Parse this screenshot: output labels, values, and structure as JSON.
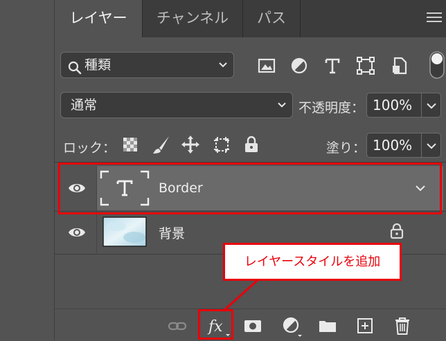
{
  "tabs": [
    {
      "label": "レイヤー",
      "active": true
    },
    {
      "label": "チャンネル",
      "active": false
    },
    {
      "label": "パス",
      "active": false
    }
  ],
  "filter": {
    "kind_label": "種類"
  },
  "blend": {
    "mode": "通常",
    "opacity_label": "不透明度：",
    "opacity_value": "100%"
  },
  "lock": {
    "label": "ロック：",
    "fill_label": "塗り：",
    "fill_value": "100%"
  },
  "layers": [
    {
      "name": "Border",
      "type": "text",
      "selected": true
    },
    {
      "name": "背景",
      "type": "image",
      "locked": true
    }
  ],
  "callout": {
    "text": "レイヤースタイルを追加"
  },
  "colors": {
    "panel_bg": "#535353",
    "tab_bar": "#3c3c3c",
    "highlight": "#e8000a",
    "selected_row": "#6a6a6a"
  }
}
